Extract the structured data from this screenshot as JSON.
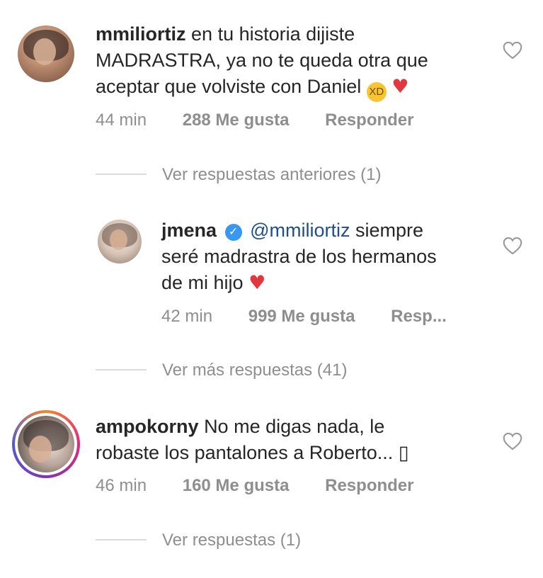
{
  "comments": [
    {
      "username": "mmiliortiz",
      "line1": "en tu historia dijiste",
      "line2": "MADRASTRA, ya no te queda otra que",
      "line3": "aceptar que volviste con Daniel",
      "time": "44 min",
      "likes": "288 Me gusta",
      "reply": "Responder"
    },
    {
      "username": "jmena",
      "mention": "@mmiliortiz",
      "line1": "siempre",
      "line2": "seré madrastra de los hermanos",
      "line3": "de mi hijo",
      "time": "42 min",
      "likes": "999 Me gusta",
      "reply": "Resp..."
    },
    {
      "username": "ampokorny",
      "line1": "No me digas nada, le",
      "line2": "robaste los pantalones a Roberto...",
      "time": "46 min",
      "likes": "160 Me gusta",
      "reply": "Responder"
    }
  ],
  "threads": {
    "previous": "Ver respuestas anteriores (1)",
    "more": "Ver más respuestas (41)",
    "replies": "Ver respuestas (1)"
  },
  "emoji": {
    "laugh": "😂",
    "heart": "♥",
    "unknown": "▯"
  },
  "colors": {
    "link": "#1f4f8a",
    "meta": "#8e8e8e",
    "heart": "#e0383e",
    "verified": "#3897f0"
  }
}
